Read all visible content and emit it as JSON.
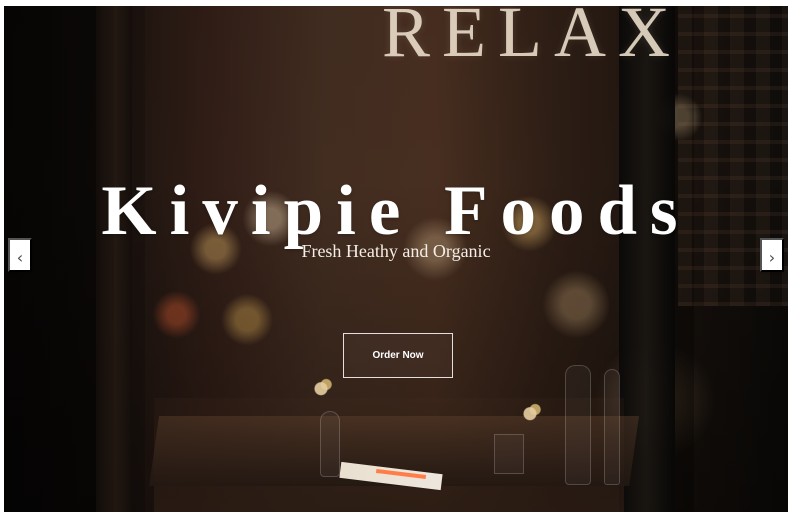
{
  "hero": {
    "background_sign": "RELAX",
    "title": "Kivipie Foods",
    "subtitle": "Fresh Heathy and Organic",
    "cta_label": "Order Now"
  },
  "slider": {
    "prev_symbol": "‹",
    "next_symbol": "›"
  },
  "theme": {
    "title_color": "#ffffff",
    "button_border": "#ffffff",
    "nav_background": "#ffffff",
    "nav_icon_color": "#4c4c4c"
  }
}
